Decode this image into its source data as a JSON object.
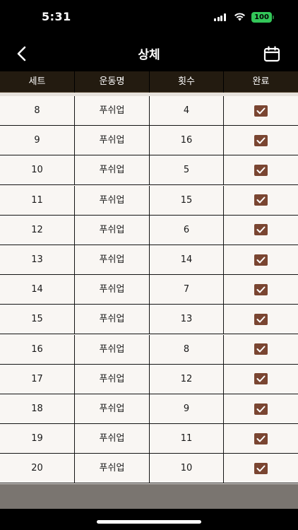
{
  "status_bar": {
    "time": "5:31",
    "battery_level": "100"
  },
  "nav": {
    "title": "상체",
    "back_icon": "chevron-left-icon",
    "calendar_icon": "calendar-icon"
  },
  "table": {
    "headers": [
      "세트",
      "운동명",
      "횟수",
      "완료"
    ],
    "rows": [
      {
        "set": "8",
        "exercise": "푸쉬업",
        "reps": "4",
        "done": true
      },
      {
        "set": "9",
        "exercise": "푸쉬업",
        "reps": "16",
        "done": true
      },
      {
        "set": "10",
        "exercise": "푸쉬업",
        "reps": "5",
        "done": true
      },
      {
        "set": "11",
        "exercise": "푸쉬업",
        "reps": "15",
        "done": true
      },
      {
        "set": "12",
        "exercise": "푸쉬업",
        "reps": "6",
        "done": true
      },
      {
        "set": "13",
        "exercise": "푸쉬업",
        "reps": "14",
        "done": true
      },
      {
        "set": "14",
        "exercise": "푸쉬업",
        "reps": "7",
        "done": true
      },
      {
        "set": "15",
        "exercise": "푸쉬업",
        "reps": "13",
        "done": true
      },
      {
        "set": "16",
        "exercise": "푸쉬업",
        "reps": "8",
        "done": true
      },
      {
        "set": "17",
        "exercise": "푸쉬업",
        "reps": "12",
        "done": true
      },
      {
        "set": "18",
        "exercise": "푸쉬업",
        "reps": "9",
        "done": true
      },
      {
        "set": "19",
        "exercise": "푸쉬업",
        "reps": "11",
        "done": true
      },
      {
        "set": "20",
        "exercise": "푸쉬업",
        "reps": "10",
        "done": true
      }
    ]
  },
  "colors": {
    "header_bg": "#231b10",
    "checkbox": "#7a4531",
    "table_bg": "#f9f6f3",
    "battery": "#33c759"
  }
}
